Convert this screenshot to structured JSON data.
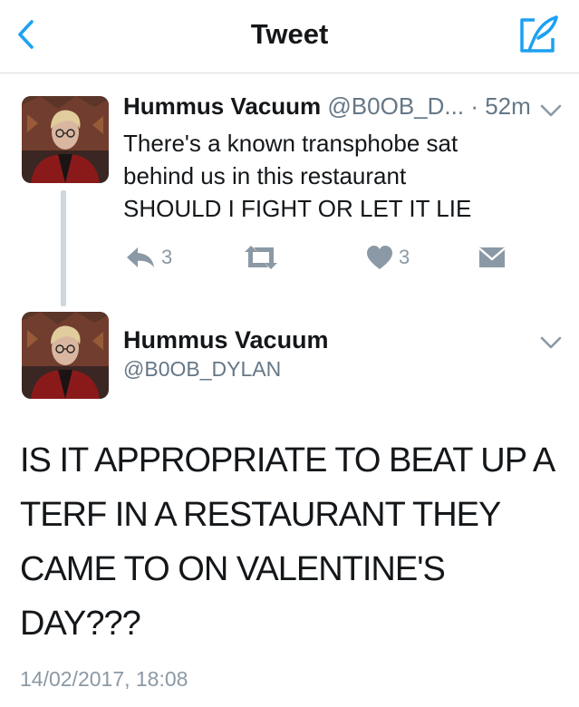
{
  "header": {
    "title": "Tweet",
    "back_icon": "chevron-left-icon",
    "compose_icon": "compose-tweet-icon",
    "accent_color": "#1da1f2"
  },
  "parent_tweet": {
    "name": "Hummus Vacuum",
    "handle": "@B0OB_D...",
    "separator": "·",
    "time": "52m",
    "text_lines": [
      "There's a known transphobe sat",
      "behind us in this restaurant",
      "SHOULD I FIGHT OR LET IT LIE"
    ],
    "actions": {
      "reply_count": "3",
      "retweet_count": "",
      "like_count": "3"
    }
  },
  "main_tweet": {
    "name": "Hummus Vacuum",
    "handle": "@B0OB_DYLAN",
    "text_lines": [
      "IS IT APPROPRIATE TO BEAT UP A",
      "TERF IN A RESTAURANT THEY",
      "CAME TO ON VALENTINE'S",
      "DAY???"
    ],
    "timestamp": "14/02/2017, 18:08"
  }
}
